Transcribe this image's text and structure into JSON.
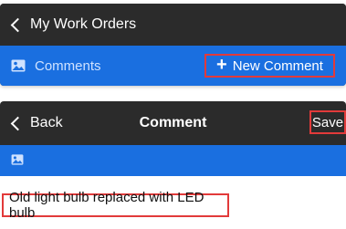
{
  "work_orders_screen": {
    "back_label": "My Work Orders",
    "tab_label": "Comments",
    "new_comment_label": "New Comment"
  },
  "comment_screen": {
    "back_label": "Back",
    "title": "Comment",
    "save_label": "Save",
    "comment_text": "Old light bulb replaced with LED bulb"
  },
  "colors": {
    "nav_background": "#2b2b2b",
    "accent_blue": "#1a6fe0",
    "highlight_red": "#e23a3a"
  },
  "icons": {
    "back": "chevron-left-icon",
    "comments": "image-icon",
    "new": "plus-icon"
  }
}
